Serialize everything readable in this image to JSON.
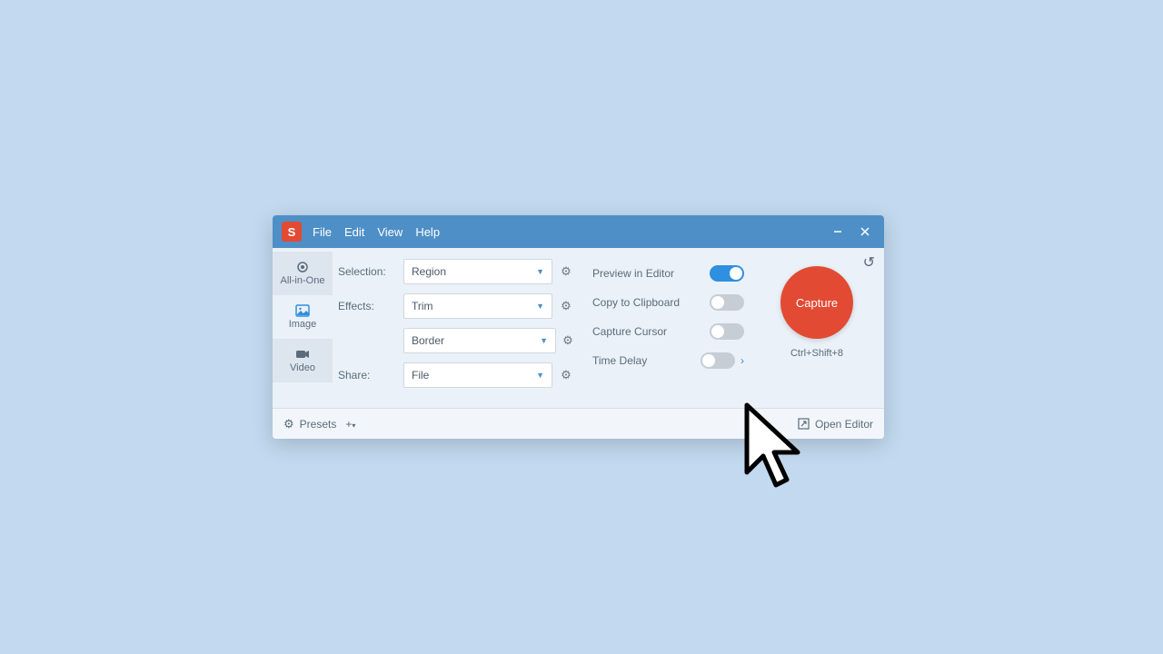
{
  "app": {
    "logo_letter": "S"
  },
  "menu": {
    "file": "File",
    "edit": "Edit",
    "view": "View",
    "help": "Help"
  },
  "tabs": {
    "all": "All-in-One",
    "image": "Image",
    "video": "Video"
  },
  "settings": {
    "selection_label": "Selection:",
    "selection_value": "Region",
    "effects_label": "Effects:",
    "effects_value1": "Trim",
    "effects_value2": "Border",
    "share_label": "Share:",
    "share_value": "File"
  },
  "toggles": {
    "preview": "Preview in Editor",
    "clipboard": "Copy to Clipboard",
    "cursor": "Capture Cursor",
    "delay": "Time Delay"
  },
  "capture": {
    "label": "Capture",
    "hotkey": "Ctrl+Shift+8"
  },
  "footer": {
    "presets": "Presets",
    "open_editor": "Open Editor"
  }
}
